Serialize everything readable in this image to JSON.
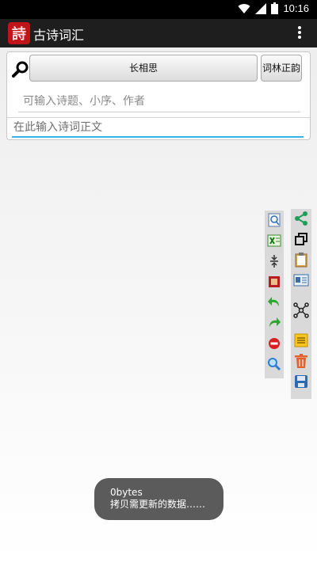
{
  "status_bar": {
    "time": "10:16"
  },
  "app_bar": {
    "logo_char": "詩",
    "title": "古诗词汇"
  },
  "search_panel": {
    "title_button_label": "长相思",
    "cilin_button_label": "词林正韵",
    "title_field_placeholder": "可输入诗题、小序、作者",
    "body_field_placeholder": "在此输入诗词正文"
  },
  "toolbar_left": [
    "preview-icon",
    "excel-icon",
    "collapse-icon",
    "book-icon",
    "undo-icon",
    "redo-icon",
    "stop-icon",
    "search-icon"
  ],
  "toolbar_right": [
    "share-icon",
    "copy-icon",
    "clipboard-icon",
    "contact-card-icon",
    "network-icon",
    "notes-icon",
    "delete-icon",
    "save-icon"
  ],
  "toast": {
    "line1": "0bytes",
    "line2": "拷贝需更新的数据……"
  }
}
